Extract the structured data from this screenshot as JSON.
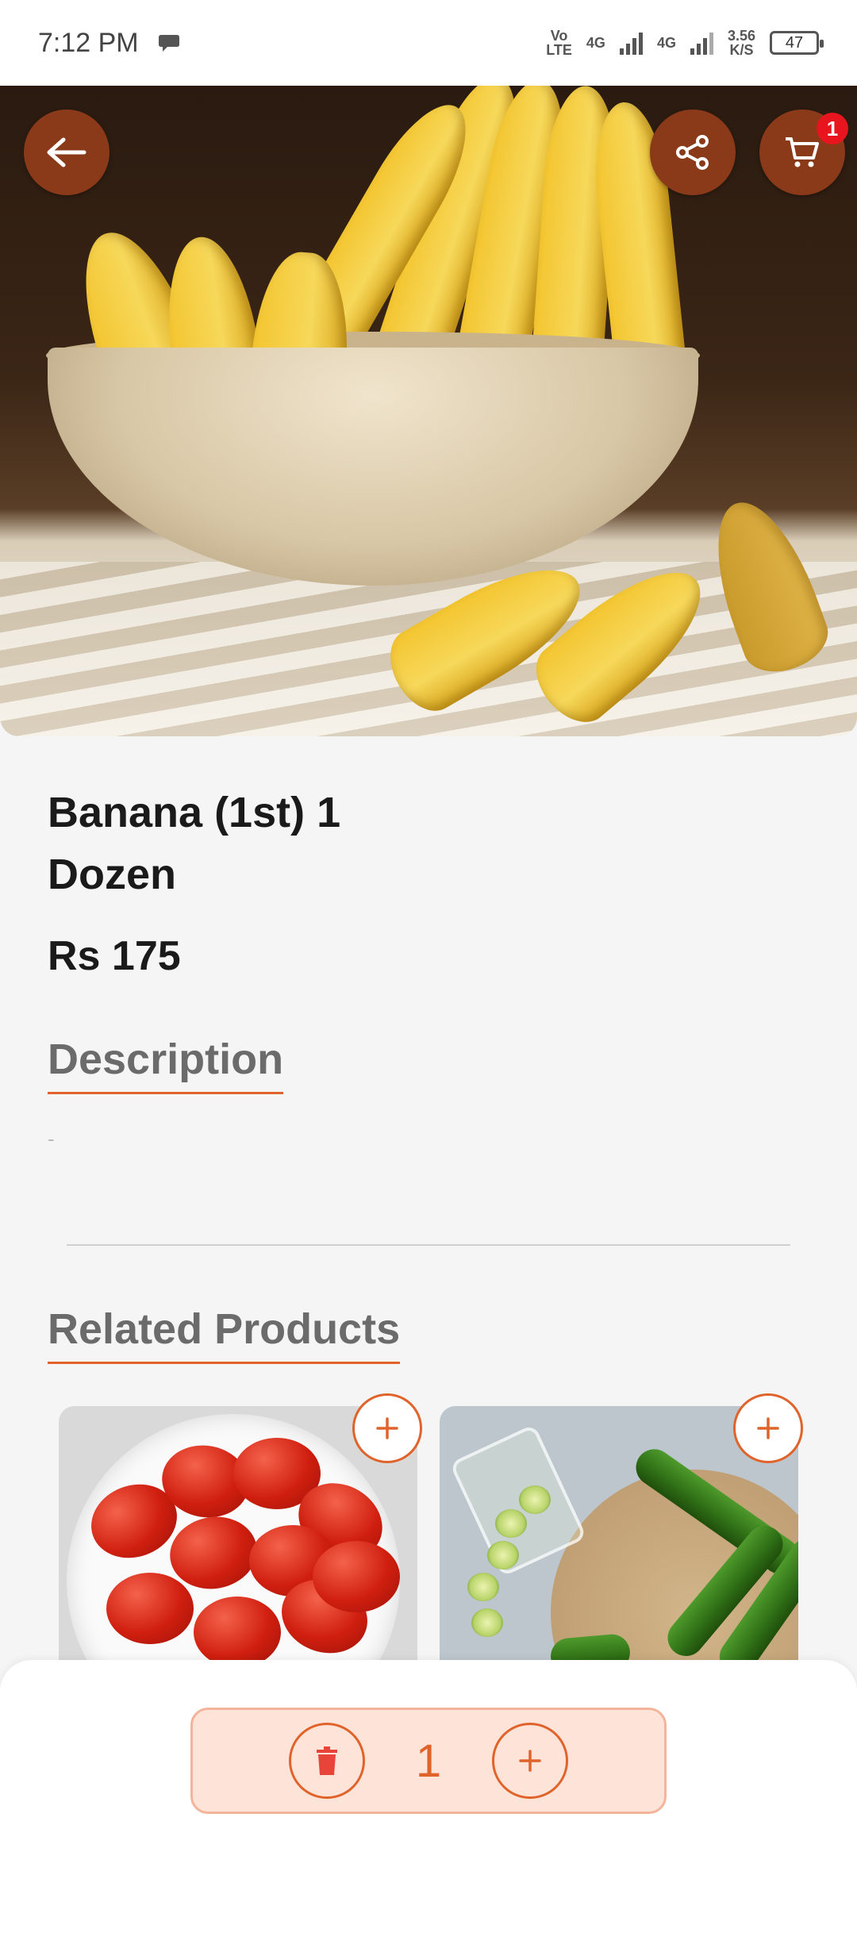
{
  "status_bar": {
    "time": "7:12 PM",
    "net1_top": "Vo",
    "net1_bottom": "LTE",
    "net2": "4G",
    "net3": "4G",
    "speed_top": "3.56",
    "speed_bottom": "K/S",
    "battery": "47"
  },
  "header": {
    "back_icon": "arrow-left-icon",
    "share_icon": "share-icon",
    "cart_icon": "cart-icon",
    "cart_count": "1"
  },
  "product": {
    "title": "Banana (1st) 1 Dozen",
    "price": "Rs 175"
  },
  "description": {
    "heading": "Description",
    "text": "-"
  },
  "related": {
    "heading": "Related Products",
    "add_icon": "plus-icon"
  },
  "cart_controls": {
    "quantity": "1",
    "delete_icon": "trash-icon",
    "increment_icon": "plus-icon"
  },
  "colors": {
    "accent": "#e0632a",
    "header_button": "#8a3a18",
    "badge": "#e8151e",
    "qty_panel_bg": "#fde3d8"
  }
}
